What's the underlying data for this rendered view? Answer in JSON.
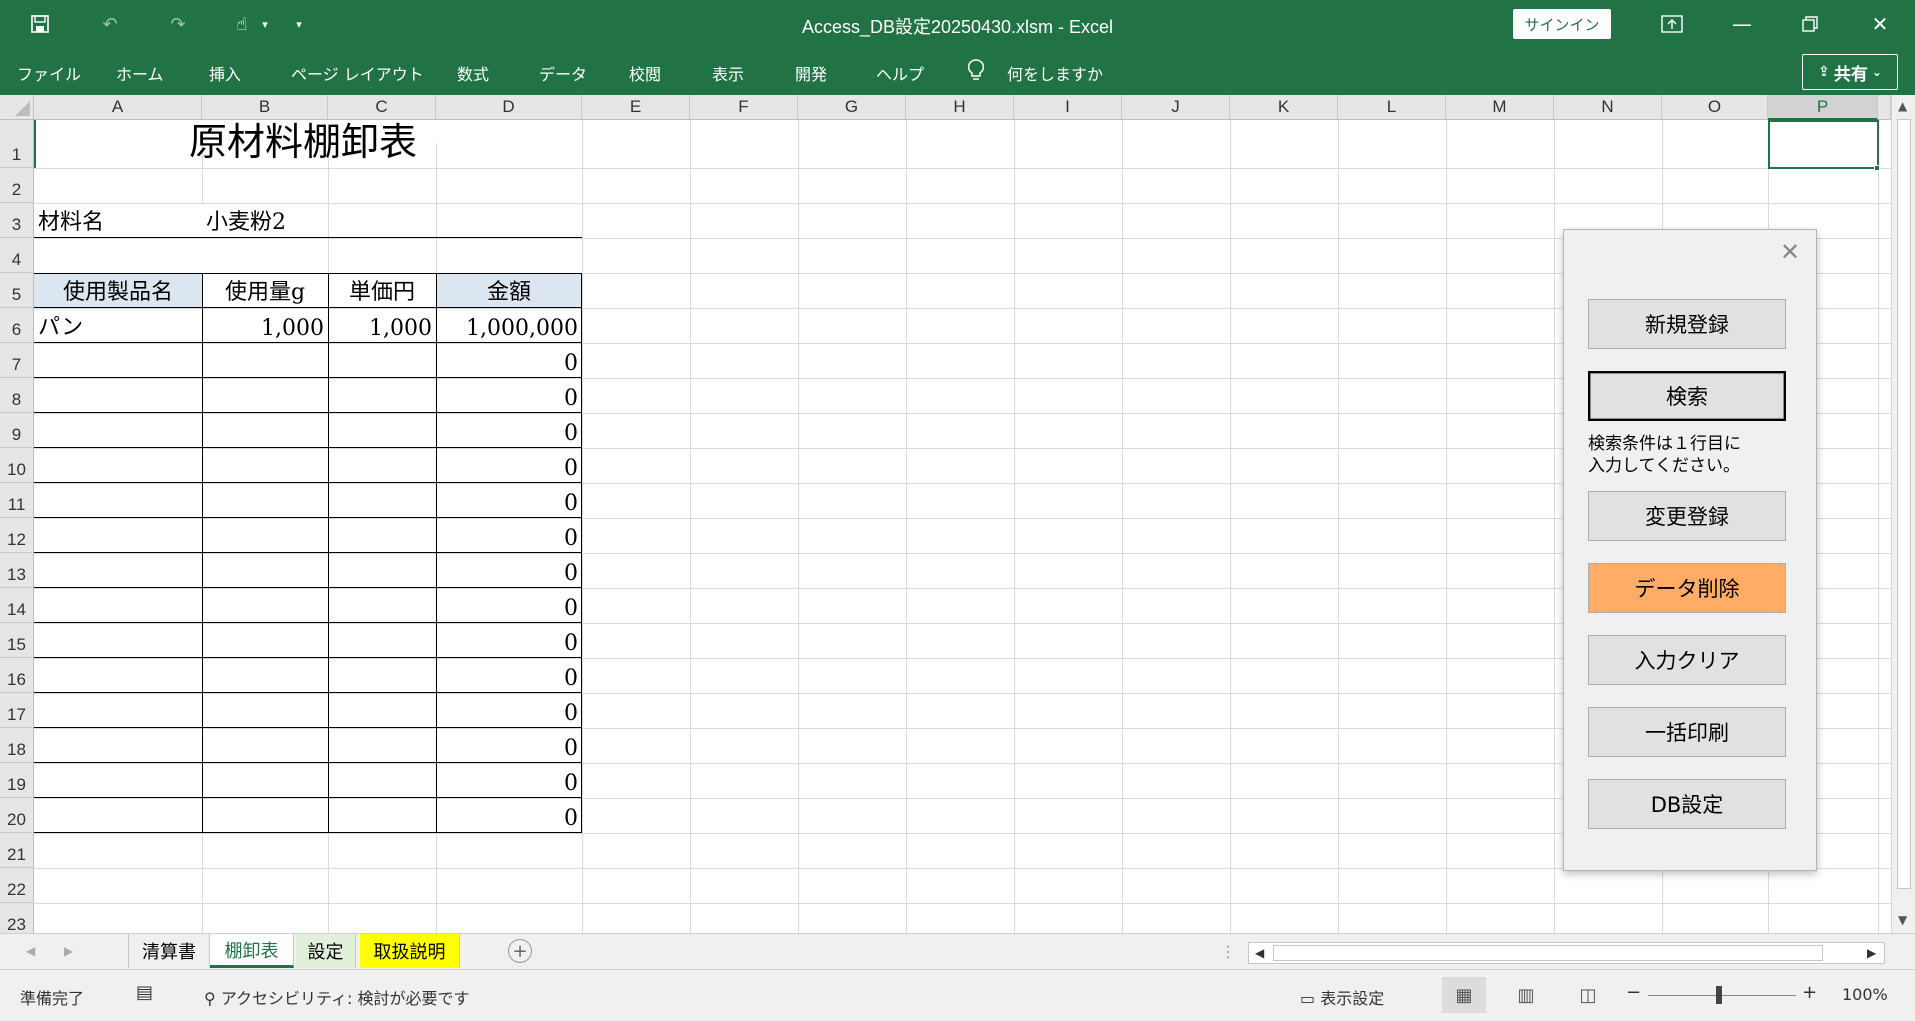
{
  "titlebar": {
    "title": "Access_DB設定20250430.xlsm  -  Excel",
    "signin": "サインイン",
    "icons": [
      "save-icon",
      "undo-icon",
      "redo-icon",
      "touch-mode-icon",
      "customize-icon"
    ]
  },
  "ribbon": {
    "tabs": [
      "ファイル",
      "ホーム",
      "挿入",
      "ページ レイアウト",
      "数式",
      "データ",
      "校閲",
      "表示",
      "開発",
      "ヘルプ"
    ],
    "tell_me": "何をしますか",
    "share": "共有"
  },
  "grid": {
    "columns": [
      "A",
      "B",
      "C",
      "D",
      "E",
      "F",
      "G",
      "H",
      "I",
      "J",
      "K",
      "L",
      "M",
      "N",
      "O",
      "P"
    ],
    "rows": [
      "1",
      "2",
      "3",
      "4",
      "5",
      "6",
      "7",
      "8",
      "9",
      "10",
      "11",
      "12",
      "13",
      "14",
      "15",
      "16",
      "17",
      "18",
      "19",
      "20",
      "21",
      "22",
      "23"
    ],
    "selected_column": "P"
  },
  "sheet": {
    "title": "原材料棚卸表",
    "material_label": "材料名",
    "material_value": "小麦粉2",
    "headers": [
      "使用製品名",
      "使用量g",
      "単価円",
      "金額"
    ],
    "first_row": {
      "product": "パン",
      "qty": "1,000",
      "price": "1,000",
      "amount": "1,000,000"
    },
    "empty_amount": "0"
  },
  "panel": {
    "buttons": {
      "new": "新規登録",
      "search": "検索",
      "update": "変更登録",
      "delete": "データ削除",
      "clear": "入力クリア",
      "print": "一括印刷",
      "db": "DB設定"
    },
    "note_line1": "検索条件は１行目に",
    "note_line2": "入力してください。",
    "delete_color": "#ffad66"
  },
  "sheet_tabs": [
    "清算書",
    "棚卸表",
    "設定",
    "取扱説明"
  ],
  "active_tab": "棚卸表",
  "status": {
    "ready": "準備完了",
    "accessibility": "アクセシビリティ: 検討が必要です",
    "display_settings": "表示設定",
    "zoom": "100%"
  },
  "colors": {
    "excel_green": "#217346",
    "header_fill": "#dce6f1",
    "highlight_tab": "#ffff00"
  }
}
